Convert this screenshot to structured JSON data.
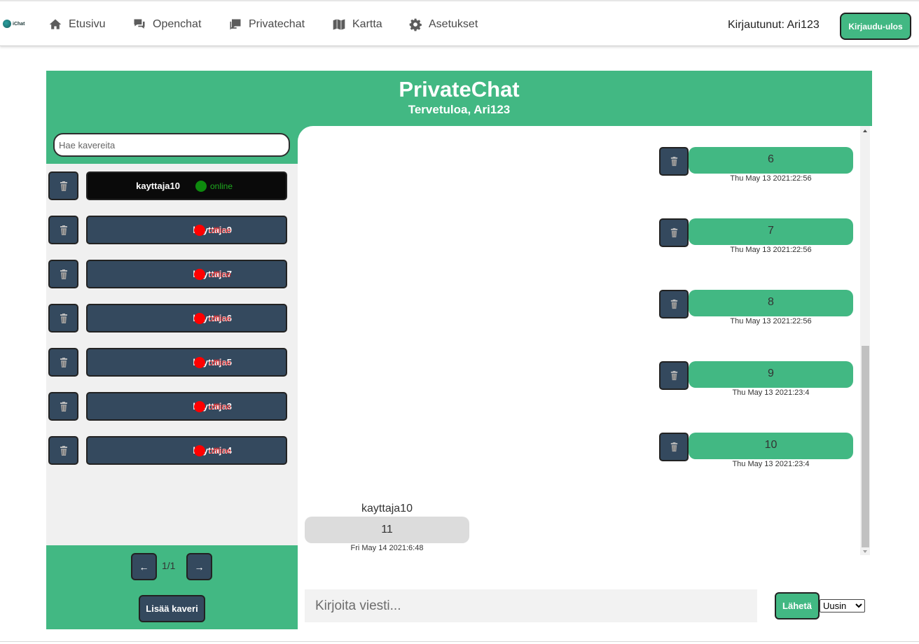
{
  "app": {
    "logo_text": "iChat"
  },
  "nav": {
    "items": [
      {
        "label": "Etusivu",
        "icon": "home-icon"
      },
      {
        "label": "Openchat",
        "icon": "chat-bubbles-icon"
      },
      {
        "label": "Privatechat",
        "icon": "private-chat-icon"
      },
      {
        "label": "Kartta",
        "icon": "map-icon"
      },
      {
        "label": "Asetukset",
        "icon": "gear-icon"
      }
    ],
    "logged_in": "Kirjautunut: Ari123",
    "logout_label": "Kirjaudu-ulos"
  },
  "header": {
    "title": "PrivateChat",
    "subtitle": "Tervetuloa, Ari123"
  },
  "sidebar": {
    "search_placeholder": "Hae kavereita",
    "friends": [
      {
        "name": "kayttaja10",
        "status": "online"
      },
      {
        "name": "kayttaja9",
        "status": "offline"
      },
      {
        "name": "kayttaja7",
        "status": "offline"
      },
      {
        "name": "kayttaja6",
        "status": "offline"
      },
      {
        "name": "kayttaja5",
        "status": "offline"
      },
      {
        "name": "kayttaja3",
        "status": "offline"
      },
      {
        "name": "kayttaja4",
        "status": "offline"
      }
    ],
    "page_indicator": "1/1",
    "prev_label": "←",
    "next_label": "→",
    "add_friend_label": "Lisää kaveri"
  },
  "chat": {
    "sent": [
      {
        "text": "6",
        "time": "Thu May 13 2021:22:56"
      },
      {
        "text": "7",
        "time": "Thu May 13 2021:22:56"
      },
      {
        "text": "8",
        "time": "Thu May 13 2021:22:56"
      },
      {
        "text": "9",
        "time": "Thu May 13 2021:23:4"
      },
      {
        "text": "10",
        "time": "Thu May 13 2021:23:4"
      }
    ],
    "received": {
      "sender": "kayttaja10",
      "text": "11",
      "time": "Fri May 14 2021:6:48"
    },
    "input_placeholder": "Kirjoita viesti...",
    "send_label": "Lähetä",
    "sort_selected": "Uusin"
  },
  "colors": {
    "accent": "#42b883",
    "dark": "#34495e",
    "online": "#0e8a0e",
    "offline": "#ff0000"
  }
}
